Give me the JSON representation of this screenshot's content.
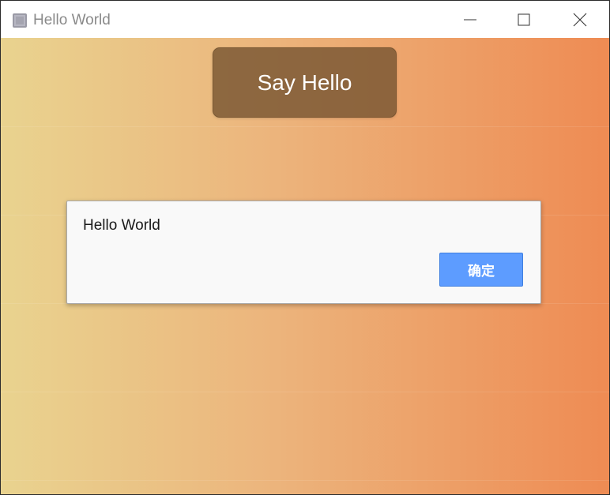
{
  "window": {
    "title": "Hello World",
    "icons": {
      "app": "window-app-icon",
      "minimize": "minimize-icon",
      "maximize": "maximize-icon",
      "close": "close-icon"
    }
  },
  "main": {
    "say_hello_label": "Say Hello",
    "background_colors": [
      "#e9d38f",
      "#ecb47c",
      "#ee8b53"
    ]
  },
  "dialog": {
    "message": "Hello World",
    "confirm_label": "确定",
    "confirm_color": "#5d9cff"
  }
}
